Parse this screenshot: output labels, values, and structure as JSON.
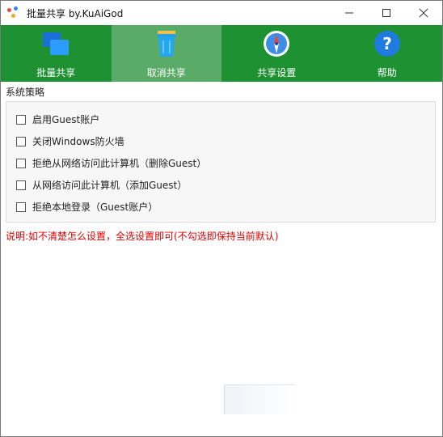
{
  "window": {
    "title": "批量共享 by.KuAiGod",
    "controls": {
      "minimize": "—",
      "maximize": "☐",
      "close": "✕"
    }
  },
  "toolbar": {
    "items": [
      {
        "label": "批量共享",
        "icon": "windows-logo-icon",
        "active": false
      },
      {
        "label": "取消共享",
        "icon": "trash-bin-icon",
        "active": true
      },
      {
        "label": "共享设置",
        "icon": "compass-icon",
        "active": false
      },
      {
        "label": "帮助",
        "icon": "help-icon",
        "active": false
      }
    ],
    "accent": "#1e9133",
    "active_color": "#5aab67"
  },
  "settings": {
    "group_title": "系统策略",
    "options": [
      {
        "label": "启用Guest账户",
        "checked": false
      },
      {
        "label": "关闭Windows防火墙",
        "checked": false
      },
      {
        "label": "拒绝从网络访问此计算机（删除Guest）",
        "checked": false
      },
      {
        "label": "从网络访问此计算机（添加Guest）",
        "checked": false
      },
      {
        "label": "拒绝本地登录（Guest账户）",
        "checked": false
      }
    ],
    "note": "说明:如不清楚怎么设置，全选设置即可(不勾选即保持当前默认)",
    "note_color": "#e00000"
  }
}
